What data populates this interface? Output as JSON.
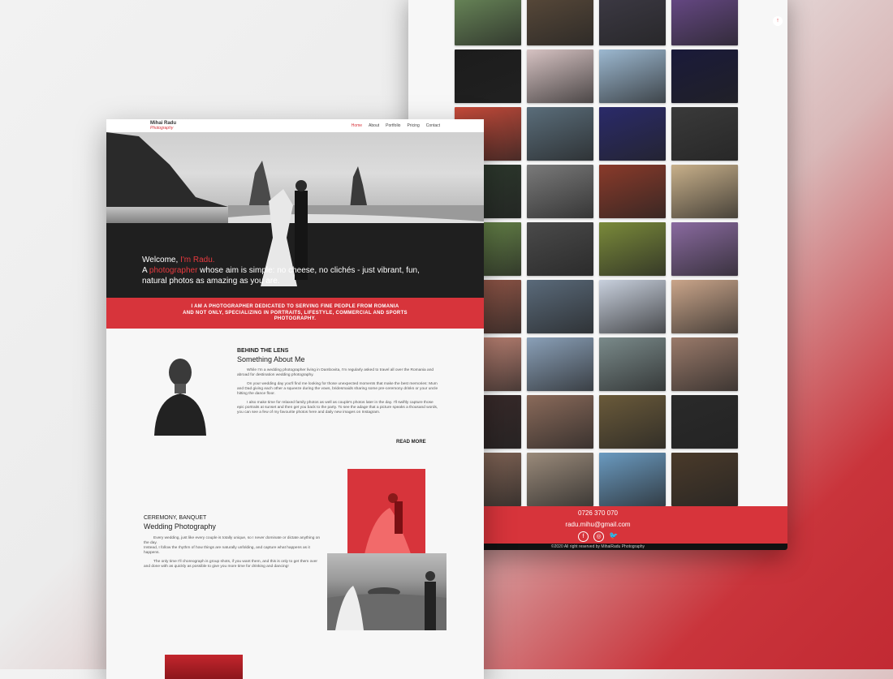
{
  "colors": {
    "accent": "#d7343b",
    "footer_dark": "#111111"
  },
  "back_window": {
    "gallery_tile_colors": [
      "#6b8a5a",
      "#5a4a3a",
      "#3d3a45",
      "#6a4a8a",
      "#1c1c1c",
      "#d6c2c2",
      "#9cb8d0",
      "#1a1a3a",
      "#c94b3a",
      "#5a6d7a",
      "#2a2a6a",
      "#3a3a3a",
      "#2d3a2d",
      "#7a7a7a",
      "#8a3a2a",
      "#c8b08a",
      "#6a8a4a",
      "#4a4a4a",
      "#7a8a3a",
      "#8a6aa0",
      "#9a5a4a",
      "#5a6a7a",
      "#c8d0dd",
      "#caa58a",
      "#c98a7a",
      "#8aa0b8",
      "#7a8a8a",
      "#9a7a6a",
      "#3a2a2a",
      "#8a6a5a",
      "#6a5a3a",
      "#2a2a2a",
      "#8a6a5a",
      "#9a8a7a",
      "#6a9ac0",
      "#4a3a2a"
    ],
    "footer": {
      "phone": "0726 370 070",
      "email": "radu.mihu@gmail.com",
      "social_icons": [
        "facebook-icon",
        "instagram-icon",
        "twitter-icon"
      ],
      "copyright": "©2020 All right reserved by MihaiRadu Photography",
      "back_to_top": "↑"
    }
  },
  "front_window": {
    "logo": {
      "name": "Mihai Radu",
      "tagline": "Photography"
    },
    "nav": [
      {
        "label": "Home",
        "active": true
      },
      {
        "label": "About",
        "active": false
      },
      {
        "label": "Portfolio",
        "active": false
      },
      {
        "label": "Pricing",
        "active": false
      },
      {
        "label": "Contact",
        "active": false
      }
    ],
    "hero": {
      "welcome_prefix": "Welcome, ",
      "welcome_name": "I'm Radu.",
      "line2_prefix": "A ",
      "line2_accent": "photographer",
      "line2_rest": " whose aim is simple: no cheese, no clichés - just vibrant, fun,",
      "line3": "natural photos as amazing as you are."
    },
    "banner": {
      "line1": "I AM A PHOTOGRAPHER DEDICATED TO SERVING FINE PEOPLE FROM ROMANIA",
      "line2": "AND NOT ONLY, SPECIALIZING IN PORTRAITS, LIFESTYLE, COMMERCIAL AND SPORTS",
      "line3": "PHOTOGRAPHY."
    },
    "about": {
      "eyebrow": "BEHIND THE LENS",
      "title": "Something About Me",
      "p1": "While I'm a wedding photographer living in Dambovita, I'm regularly asked to travel all over the Romania and abroad for destination wedding photography.",
      "p2": "On your wedding day you'll find me looking for those unexpected moments that make the best memories: Mum and Dad giving each other a squeeze during the vows, bridesmaids sharing some pre-ceremony drinks or your uncle hitting the dance floor.",
      "p3": "I also make time for relaxed family photos as well as couple's photos later in the day. I'll swiftly capture those epic portraits at sunset and then get you back to the party. To see the adage that a picture speaks a thousand words, you can see a few of my favourite photos here and daily new images on Instagram.",
      "read_more": "READ MORE"
    },
    "wedding": {
      "eyebrow": "CEREMONY, BANQUET",
      "title": "Wedding Photography",
      "p1": "Every wedding, just like every couple is totally unique, so I never dominate or dictate anything on the day.",
      "p1b": "Instead, I follow the rhythm of how things are naturally unfolding, and capture what happens as it happens.",
      "p2": "The only time I'll choreograph is group shots, if you want them, and this is only to get them over and done with as quickly as possible to give you more time for drinking and dancing!"
    }
  }
}
